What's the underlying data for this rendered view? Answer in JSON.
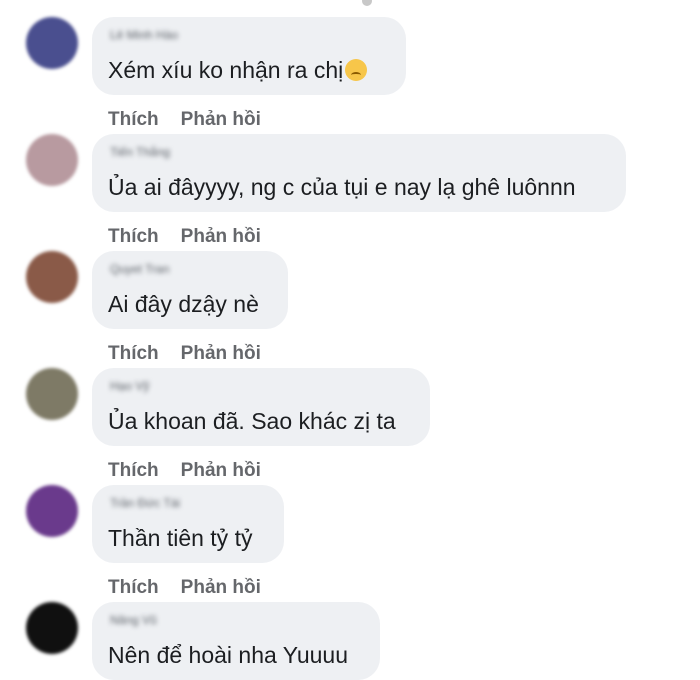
{
  "comments": [
    {
      "name": "Lê Minh Hào",
      "text": "Xém xíu ko nhận ra chị",
      "emoji": "pleading-face",
      "like": "Thích",
      "reply": "Phản hồi",
      "avatar_color": "#4a4f8f"
    },
    {
      "name": "Tiến Thắng",
      "text": "Ủa ai đâyyyy, ng c của tụi e nay lạ ghê luônnn",
      "like": "Thích",
      "reply": "Phản hồi",
      "avatar_color": "#b89aa0"
    },
    {
      "name": "Quyet Tran",
      "text": "Ai đây dzậy nè",
      "like": "Thích",
      "reply": "Phản hồi",
      "avatar_color": "#8a5a48"
    },
    {
      "name": "Hạo Vỹ",
      "text": "Ủa khoan đã. Sao khác zị ta",
      "like": "Thích",
      "reply": "Phản hồi",
      "avatar_color": "#7e7a66"
    },
    {
      "name": "Trần Đức Tài",
      "text": "Thần tiên tỷ tỷ",
      "like": "Thích",
      "reply": "Phản hồi",
      "avatar_color": "#6a3a8c"
    },
    {
      "name": "Năng Vũ",
      "text": "Nên để hoài nha Yuuuu",
      "avatar_color": "#101010"
    }
  ]
}
